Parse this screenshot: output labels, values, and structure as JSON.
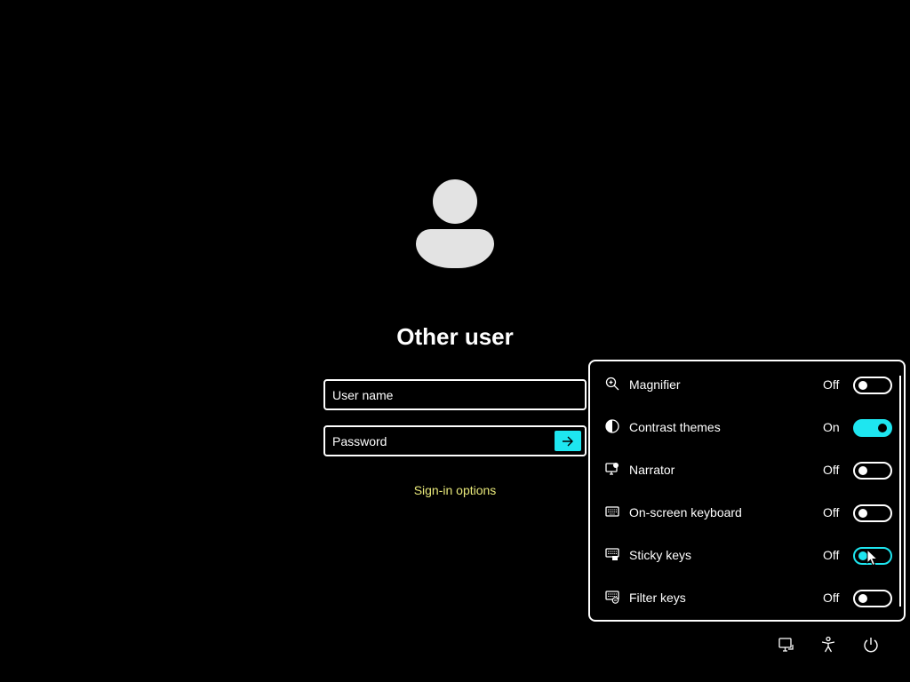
{
  "user": {
    "title": "Other user"
  },
  "form": {
    "username_placeholder": "User name",
    "password_placeholder": "Password",
    "submit_icon": "arrow-right-icon",
    "signin_options": "Sign-in options"
  },
  "accessibility": {
    "items": [
      {
        "label": "Magnifier",
        "state": "Off",
        "icon": "magnifier-icon",
        "on": false
      },
      {
        "label": "Contrast themes",
        "state": "On",
        "icon": "contrast-icon",
        "on": true
      },
      {
        "label": "Narrator",
        "state": "Off",
        "icon": "narrator-icon",
        "on": false
      },
      {
        "label": "On-screen keyboard",
        "state": "Off",
        "icon": "keyboard-icon",
        "on": false
      },
      {
        "label": "Sticky keys",
        "state": "Off",
        "icon": "sticky-keys-icon",
        "on": false
      },
      {
        "label": "Filter keys",
        "state": "Off",
        "icon": "filter-keys-icon",
        "on": false
      }
    ]
  },
  "tray": {
    "network_icon": "network-icon",
    "accessibility_icon": "accessibility-icon",
    "power_icon": "power-icon"
  },
  "colors": {
    "accent": "#1ee6f0",
    "link": "#e8e87a",
    "background": "#000000",
    "foreground": "#ffffff"
  }
}
